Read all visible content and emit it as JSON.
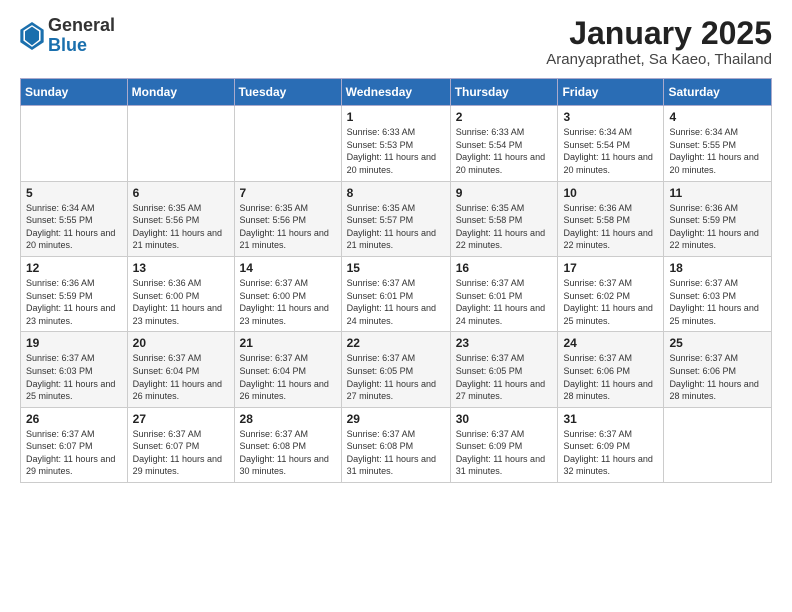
{
  "header": {
    "logo_general": "General",
    "logo_blue": "Blue",
    "title": "January 2025",
    "subtitle": "Aranyaprathet, Sa Kaeo, Thailand"
  },
  "weekdays": [
    "Sunday",
    "Monday",
    "Tuesday",
    "Wednesday",
    "Thursday",
    "Friday",
    "Saturday"
  ],
  "weeks": [
    [
      {
        "day": "",
        "info": ""
      },
      {
        "day": "",
        "info": ""
      },
      {
        "day": "",
        "info": ""
      },
      {
        "day": "1",
        "info": "Sunrise: 6:33 AM\nSunset: 5:53 PM\nDaylight: 11 hours and 20 minutes."
      },
      {
        "day": "2",
        "info": "Sunrise: 6:33 AM\nSunset: 5:54 PM\nDaylight: 11 hours and 20 minutes."
      },
      {
        "day": "3",
        "info": "Sunrise: 6:34 AM\nSunset: 5:54 PM\nDaylight: 11 hours and 20 minutes."
      },
      {
        "day": "4",
        "info": "Sunrise: 6:34 AM\nSunset: 5:55 PM\nDaylight: 11 hours and 20 minutes."
      }
    ],
    [
      {
        "day": "5",
        "info": "Sunrise: 6:34 AM\nSunset: 5:55 PM\nDaylight: 11 hours and 20 minutes."
      },
      {
        "day": "6",
        "info": "Sunrise: 6:35 AM\nSunset: 5:56 PM\nDaylight: 11 hours and 21 minutes."
      },
      {
        "day": "7",
        "info": "Sunrise: 6:35 AM\nSunset: 5:56 PM\nDaylight: 11 hours and 21 minutes."
      },
      {
        "day": "8",
        "info": "Sunrise: 6:35 AM\nSunset: 5:57 PM\nDaylight: 11 hours and 21 minutes."
      },
      {
        "day": "9",
        "info": "Sunrise: 6:35 AM\nSunset: 5:58 PM\nDaylight: 11 hours and 22 minutes."
      },
      {
        "day": "10",
        "info": "Sunrise: 6:36 AM\nSunset: 5:58 PM\nDaylight: 11 hours and 22 minutes."
      },
      {
        "day": "11",
        "info": "Sunrise: 6:36 AM\nSunset: 5:59 PM\nDaylight: 11 hours and 22 minutes."
      }
    ],
    [
      {
        "day": "12",
        "info": "Sunrise: 6:36 AM\nSunset: 5:59 PM\nDaylight: 11 hours and 23 minutes."
      },
      {
        "day": "13",
        "info": "Sunrise: 6:36 AM\nSunset: 6:00 PM\nDaylight: 11 hours and 23 minutes."
      },
      {
        "day": "14",
        "info": "Sunrise: 6:37 AM\nSunset: 6:00 PM\nDaylight: 11 hours and 23 minutes."
      },
      {
        "day": "15",
        "info": "Sunrise: 6:37 AM\nSunset: 6:01 PM\nDaylight: 11 hours and 24 minutes."
      },
      {
        "day": "16",
        "info": "Sunrise: 6:37 AM\nSunset: 6:01 PM\nDaylight: 11 hours and 24 minutes."
      },
      {
        "day": "17",
        "info": "Sunrise: 6:37 AM\nSunset: 6:02 PM\nDaylight: 11 hours and 25 minutes."
      },
      {
        "day": "18",
        "info": "Sunrise: 6:37 AM\nSunset: 6:03 PM\nDaylight: 11 hours and 25 minutes."
      }
    ],
    [
      {
        "day": "19",
        "info": "Sunrise: 6:37 AM\nSunset: 6:03 PM\nDaylight: 11 hours and 25 minutes."
      },
      {
        "day": "20",
        "info": "Sunrise: 6:37 AM\nSunset: 6:04 PM\nDaylight: 11 hours and 26 minutes."
      },
      {
        "day": "21",
        "info": "Sunrise: 6:37 AM\nSunset: 6:04 PM\nDaylight: 11 hours and 26 minutes."
      },
      {
        "day": "22",
        "info": "Sunrise: 6:37 AM\nSunset: 6:05 PM\nDaylight: 11 hours and 27 minutes."
      },
      {
        "day": "23",
        "info": "Sunrise: 6:37 AM\nSunset: 6:05 PM\nDaylight: 11 hours and 27 minutes."
      },
      {
        "day": "24",
        "info": "Sunrise: 6:37 AM\nSunset: 6:06 PM\nDaylight: 11 hours and 28 minutes."
      },
      {
        "day": "25",
        "info": "Sunrise: 6:37 AM\nSunset: 6:06 PM\nDaylight: 11 hours and 28 minutes."
      }
    ],
    [
      {
        "day": "26",
        "info": "Sunrise: 6:37 AM\nSunset: 6:07 PM\nDaylight: 11 hours and 29 minutes."
      },
      {
        "day": "27",
        "info": "Sunrise: 6:37 AM\nSunset: 6:07 PM\nDaylight: 11 hours and 29 minutes."
      },
      {
        "day": "28",
        "info": "Sunrise: 6:37 AM\nSunset: 6:08 PM\nDaylight: 11 hours and 30 minutes."
      },
      {
        "day": "29",
        "info": "Sunrise: 6:37 AM\nSunset: 6:08 PM\nDaylight: 11 hours and 31 minutes."
      },
      {
        "day": "30",
        "info": "Sunrise: 6:37 AM\nSunset: 6:09 PM\nDaylight: 11 hours and 31 minutes."
      },
      {
        "day": "31",
        "info": "Sunrise: 6:37 AM\nSunset: 6:09 PM\nDaylight: 11 hours and 32 minutes."
      },
      {
        "day": "",
        "info": ""
      }
    ]
  ]
}
